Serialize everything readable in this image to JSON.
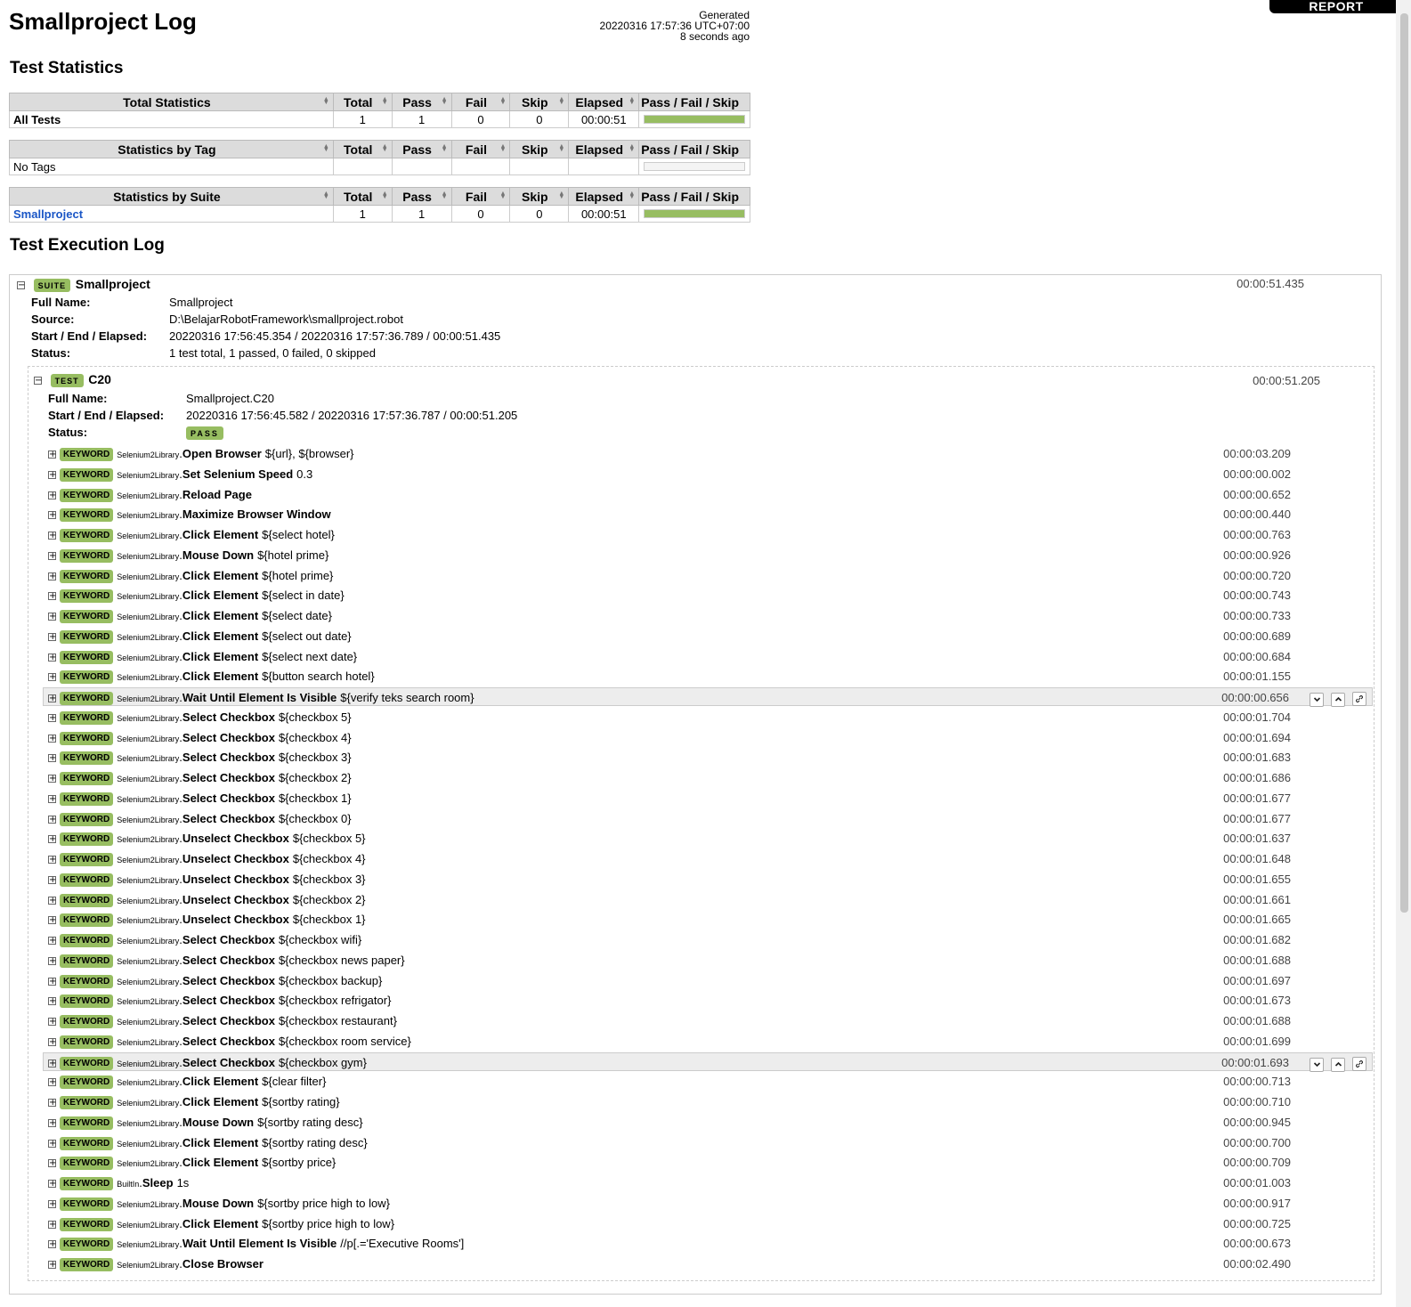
{
  "report_tab": "REPORT",
  "title": "Smallproject Log",
  "generated": {
    "label": "Generated",
    "timestamp": "20220316 17:57:36 UTC+07:00",
    "ago": "8 seconds ago"
  },
  "sections": {
    "statistics": "Test Statistics",
    "execution": "Test Execution Log"
  },
  "stat_columns": [
    "Total",
    "Pass",
    "Fail",
    "Skip",
    "Elapsed",
    "Pass / Fail / Skip"
  ],
  "stats": {
    "total": {
      "header": "Total Statistics",
      "name": "All Tests",
      "total": "1",
      "pass": "1",
      "fail": "0",
      "skip": "0",
      "elapsed": "00:00:51",
      "pass_fraction": 1
    },
    "tag": {
      "header": "Statistics by Tag",
      "name": "No Tags",
      "total": "",
      "pass": "",
      "fail": "",
      "skip": "",
      "elapsed": "",
      "pass_fraction": 0
    },
    "suite": {
      "header": "Statistics by Suite",
      "name": "Smallproject",
      "total": "1",
      "pass": "1",
      "fail": "0",
      "skip": "0",
      "elapsed": "00:00:51",
      "pass_fraction": 1
    }
  },
  "suite": {
    "label": "SUITE",
    "name": "Smallproject",
    "elapsed": "00:00:51.435",
    "meta": [
      {
        "key": "Full Name:",
        "value": "Smallproject"
      },
      {
        "key": "Source:",
        "value": "D:\\BelajarRobotFramework\\smallproject.robot"
      },
      {
        "key": "Start / End / Elapsed:",
        "value": "20220316 17:56:45.354 / 20220316 17:57:36.789 / 00:00:51.435"
      },
      {
        "key": "Status:",
        "value": "1 test total, 1 passed, 0 failed, 0 skipped"
      }
    ]
  },
  "test": {
    "label": "TEST",
    "name": "C20",
    "elapsed": "00:00:51.205",
    "meta": [
      {
        "key": "Full Name:",
        "value": "Smallproject.C20"
      },
      {
        "key": "Start / End / Elapsed:",
        "value": "20220316 17:56:45.582 / 20220316 17:57:36.787 / 00:00:51.205"
      },
      {
        "key": "Status:",
        "value": "PASS"
      }
    ]
  },
  "keyword_label": "KEYWORD",
  "keywords": [
    {
      "lib": "Selenium2Library",
      "name": "Open Browser",
      "args": "${url}, ${browser}",
      "elapsed": "00:00:03.209"
    },
    {
      "lib": "Selenium2Library",
      "name": "Set Selenium Speed",
      "args": "0.3",
      "elapsed": "00:00:00.002"
    },
    {
      "lib": "Selenium2Library",
      "name": "Reload Page",
      "args": "",
      "elapsed": "00:00:00.652"
    },
    {
      "lib": "Selenium2Library",
      "name": "Maximize Browser Window",
      "args": "",
      "elapsed": "00:00:00.440"
    },
    {
      "lib": "Selenium2Library",
      "name": "Click Element",
      "args": "${select hotel}",
      "elapsed": "00:00:00.763"
    },
    {
      "lib": "Selenium2Library",
      "name": "Mouse Down",
      "args": "${hotel prime}",
      "elapsed": "00:00:00.926"
    },
    {
      "lib": "Selenium2Library",
      "name": "Click Element",
      "args": "${hotel prime}",
      "elapsed": "00:00:00.720"
    },
    {
      "lib": "Selenium2Library",
      "name": "Click Element",
      "args": "${select in date}",
      "elapsed": "00:00:00.743"
    },
    {
      "lib": "Selenium2Library",
      "name": "Click Element",
      "args": "${select date}",
      "elapsed": "00:00:00.733"
    },
    {
      "lib": "Selenium2Library",
      "name": "Click Element",
      "args": "${select out date}",
      "elapsed": "00:00:00.689"
    },
    {
      "lib": "Selenium2Library",
      "name": "Click Element",
      "args": "${select next date}",
      "elapsed": "00:00:00.684"
    },
    {
      "lib": "Selenium2Library",
      "name": "Click Element",
      "args": "${button search hotel}",
      "elapsed": "00:00:01.155"
    },
    {
      "lib": "Selenium2Library",
      "name": "Wait Until Element Is Visible",
      "args": "${verify teks search room}",
      "elapsed": "00:00:00.656",
      "highlight": true
    },
    {
      "lib": "Selenium2Library",
      "name": "Select Checkbox",
      "args": "${checkbox 5}",
      "elapsed": "00:00:01.704"
    },
    {
      "lib": "Selenium2Library",
      "name": "Select Checkbox",
      "args": "${checkbox 4}",
      "elapsed": "00:00:01.694"
    },
    {
      "lib": "Selenium2Library",
      "name": "Select Checkbox",
      "args": "${checkbox 3}",
      "elapsed": "00:00:01.683"
    },
    {
      "lib": "Selenium2Library",
      "name": "Select Checkbox",
      "args": "${checkbox 2}",
      "elapsed": "00:00:01.686"
    },
    {
      "lib": "Selenium2Library",
      "name": "Select Checkbox",
      "args": "${checkbox 1}",
      "elapsed": "00:00:01.677"
    },
    {
      "lib": "Selenium2Library",
      "name": "Select Checkbox",
      "args": "${checkbox 0}",
      "elapsed": "00:00:01.677"
    },
    {
      "lib": "Selenium2Library",
      "name": "Unselect Checkbox",
      "args": "${checkbox 5}",
      "elapsed": "00:00:01.637"
    },
    {
      "lib": "Selenium2Library",
      "name": "Unselect Checkbox",
      "args": "${checkbox 4}",
      "elapsed": "00:00:01.648"
    },
    {
      "lib": "Selenium2Library",
      "name": "Unselect Checkbox",
      "args": "${checkbox 3}",
      "elapsed": "00:00:01.655"
    },
    {
      "lib": "Selenium2Library",
      "name": "Unselect Checkbox",
      "args": "${checkbox 2}",
      "elapsed": "00:00:01.661"
    },
    {
      "lib": "Selenium2Library",
      "name": "Unselect Checkbox",
      "args": "${checkbox 1}",
      "elapsed": "00:00:01.665"
    },
    {
      "lib": "Selenium2Library",
      "name": "Select Checkbox",
      "args": "${checkbox wifi}",
      "elapsed": "00:00:01.682"
    },
    {
      "lib": "Selenium2Library",
      "name": "Select Checkbox",
      "args": "${checkbox news paper}",
      "elapsed": "00:00:01.688"
    },
    {
      "lib": "Selenium2Library",
      "name": "Select Checkbox",
      "args": "${checkbox backup}",
      "elapsed": "00:00:01.697"
    },
    {
      "lib": "Selenium2Library",
      "name": "Select Checkbox",
      "args": "${checkbox refrigator}",
      "elapsed": "00:00:01.673"
    },
    {
      "lib": "Selenium2Library",
      "name": "Select Checkbox",
      "args": "${checkbox restaurant}",
      "elapsed": "00:00:01.688"
    },
    {
      "lib": "Selenium2Library",
      "name": "Select Checkbox",
      "args": "${checkbox room service}",
      "elapsed": "00:00:01.699"
    },
    {
      "lib": "Selenium2Library",
      "name": "Select Checkbox",
      "args": "${checkbox gym}",
      "elapsed": "00:00:01.693",
      "highlight": true
    },
    {
      "lib": "Selenium2Library",
      "name": "Click Element",
      "args": "${clear filter}",
      "elapsed": "00:00:00.713"
    },
    {
      "lib": "Selenium2Library",
      "name": "Click Element",
      "args": "${sortby rating}",
      "elapsed": "00:00:00.710"
    },
    {
      "lib": "Selenium2Library",
      "name": "Mouse Down",
      "args": "${sortby rating desc}",
      "elapsed": "00:00:00.945"
    },
    {
      "lib": "Selenium2Library",
      "name": "Click Element",
      "args": "${sortby rating desc}",
      "elapsed": "00:00:00.700"
    },
    {
      "lib": "Selenium2Library",
      "name": "Click Element",
      "args": "${sortby price}",
      "elapsed": "00:00:00.709"
    },
    {
      "lib": "BuiltIn",
      "name": "Sleep",
      "args": "1s",
      "elapsed": "00:00:01.003"
    },
    {
      "lib": "Selenium2Library",
      "name": "Mouse Down",
      "args": "${sortby price high to low}",
      "elapsed": "00:00:00.917"
    },
    {
      "lib": "Selenium2Library",
      "name": "Click Element",
      "args": "${sortby price high to low}",
      "elapsed": "00:00:00.725"
    },
    {
      "lib": "Selenium2Library",
      "name": "Wait Until Element Is Visible",
      "args": "//p[.='Executive Rooms']",
      "elapsed": "00:00:00.673"
    },
    {
      "lib": "Selenium2Library",
      "name": "Close Browser",
      "args": "",
      "elapsed": "00:00:02.490"
    }
  ],
  "icons": {
    "expand": "plus-icon",
    "collapse": "minus-icon",
    "sort": "sort-icon",
    "expand_all": "chevron-down-icon",
    "collapse_all": "chevron-up-icon",
    "link": "link-icon"
  },
  "colors": {
    "pass": "#97bd61",
    "link": "#1a56c6"
  }
}
